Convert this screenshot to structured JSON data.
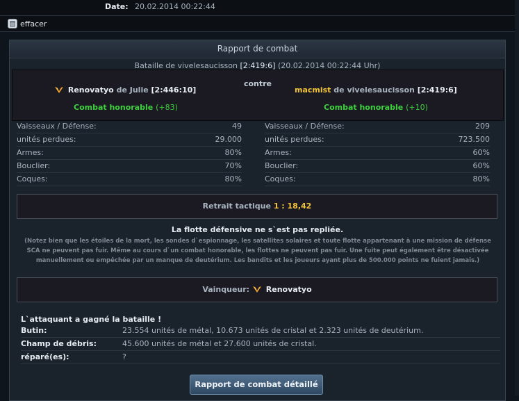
{
  "header": {
    "date_label": "Date:",
    "date_value": "20.02.2014 00:22:44"
  },
  "delete": {
    "label": "effacer",
    "icon": "trash-icon"
  },
  "report": {
    "title": "Rapport de combat",
    "battle_prefix": "Bataille de vivelesaucisson",
    "battle_coords": "[2:419:6]",
    "battle_time": "(20.02.2014 00:22:44 Uhr)",
    "contre": "contre",
    "attacker": {
      "name": "Renovatyo",
      "from": "de Julie",
      "coords": "[2:446:10]",
      "honor_label": "Combat honorable",
      "honor_value": "(+83)",
      "stats": [
        {
          "label": "Vaisseaux / Défense:",
          "value": "49"
        },
        {
          "label": "unités perdues:",
          "value": "29.000"
        },
        {
          "label": "Armes:",
          "value": "80%"
        },
        {
          "label": "Bouclier:",
          "value": "70%"
        },
        {
          "label": "Coques:",
          "value": "80%"
        }
      ]
    },
    "defender": {
      "name": "macmist",
      "from": "de vivelesaucisson",
      "coords": "[2:419:6]",
      "honor_label": "Combat honorable",
      "honor_value": "(+10)",
      "stats": [
        {
          "label": "Vaisseaux / Défense:",
          "value": "209"
        },
        {
          "label": "unités perdues:",
          "value": "723.500"
        },
        {
          "label": "Armes:",
          "value": "60%"
        },
        {
          "label": "Bouclier:",
          "value": "60%"
        },
        {
          "label": "Coques:",
          "value": "80%"
        }
      ]
    },
    "retreat_label": "Retrait tactique",
    "retreat_ratio": "1 : 18,42",
    "fleet_heading": "La flotte défensive ne s`est pas repliée.",
    "fleet_note": "(Notez bien que les étoiles de la mort, les sondes d`espionnage, les satellites solaires et toute flotte appartenant à une mission de défense SCA ne peuvent pas fuir. Même au cours d`un combat honorable, les flottes ne peuvent pas fuir. Une fuite peut également être désactivée manuellement ou empêchée par un manque de deutérium. Les bandits et les joueurs ayant plus de 500.000 points ne fuient jamais.)",
    "winner_label": "Vainqueur:",
    "winner_name": "Renovatyo",
    "result_heading": "L`attaquant a gagné la bataille !",
    "results": [
      {
        "label": "Butin:",
        "value": "23.554 unités de métal, 10.673 unités de cristal et 2.323 unités de deutérium."
      },
      {
        "label": "Champ de débris:",
        "value": "45.600 unités de métal et 27.600 unités de cristal."
      },
      {
        "label": "réparé(es):",
        "value": "?"
      }
    ],
    "detail_button": "Rapport de combat détaillé"
  },
  "colors": {
    "accent_gold": "#f2c43c",
    "honor_green": "#3ed13e",
    "panel_bg": "#1a222c"
  }
}
